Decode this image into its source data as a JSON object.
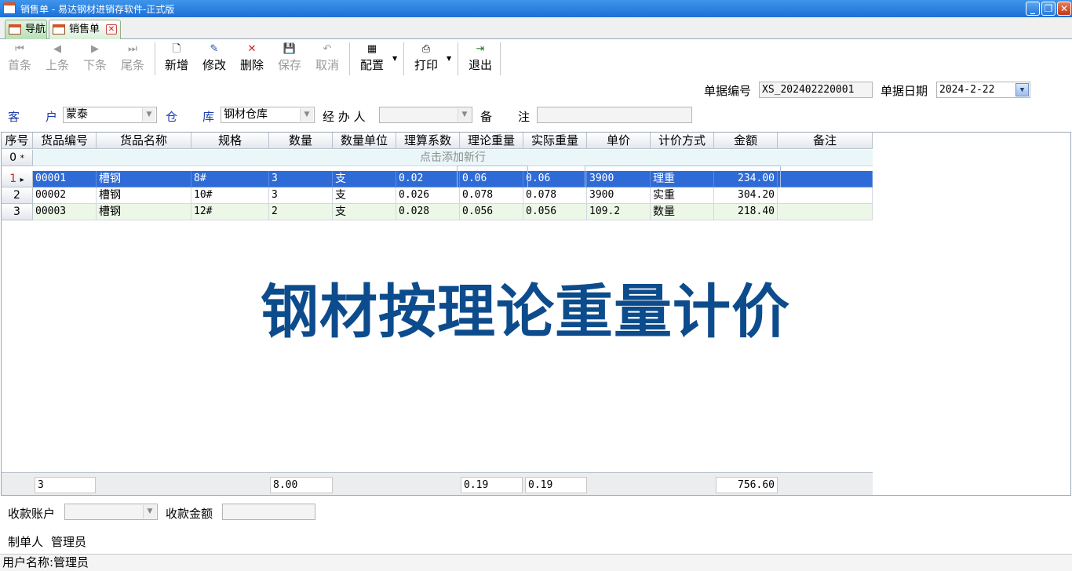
{
  "window": {
    "title": "销售单 - 易达钢材进销存软件-正式版",
    "min_glyph": "_",
    "max_glyph": "❐",
    "close_glyph": "✕"
  },
  "tabs": [
    {
      "label": "导航"
    },
    {
      "label": "销售单",
      "close_glyph": "✕"
    }
  ],
  "toolbar": {
    "first": "首条",
    "prev": "上条",
    "next": "下条",
    "last": "尾条",
    "new": "新增",
    "edit": "修改",
    "delete": "删除",
    "save": "保存",
    "cancel": "取消",
    "config": "配置",
    "print": "打印",
    "exit": "退出",
    "icons": {
      "first": "⏮",
      "prev": "◀",
      "next": "▶",
      "last": "⏭",
      "new": "🗋",
      "edit": "✎",
      "delete": "✕",
      "save": "💾",
      "cancel": "↶",
      "config": "▦",
      "print": "⎙",
      "exit": "⇥",
      "drop": "▼"
    }
  },
  "header": {
    "doc_no_label": "单据编号",
    "doc_no": "XS_202402220001",
    "doc_date_label": "单据日期",
    "doc_date": "2024-2-22",
    "customer_label_1": "客",
    "customer_label_2": "户",
    "customer": "蒙泰",
    "warehouse_label_1": "仓",
    "warehouse_label_2": "库",
    "warehouse": "钢材仓库",
    "handler_label": "经 办 人",
    "handler": "",
    "note_label_1": "备",
    "note_label_2": "注",
    "note": "",
    "dropdown_glyph": "▼"
  },
  "grid": {
    "columns": [
      "序号",
      "货品编号",
      "货品名称",
      "规格",
      "数量",
      "数量单位",
      "理算系数",
      "理论重量",
      "实际重量",
      "单价",
      "计价方式",
      "金额",
      "备注"
    ],
    "new_row": {
      "index": "0",
      "marker": "*",
      "text": "点击添加新行"
    },
    "current_marker": "▸",
    "rows": [
      {
        "index": "1",
        "code": "00001",
        "name": "槽钢",
        "spec": "8#",
        "qty": "3",
        "unit": "支",
        "coef": "0.02",
        "theo_wt": "0.06",
        "act_wt": "0.06",
        "price": "3900",
        "method": "理重",
        "amount": "234.00",
        "note": ""
      },
      {
        "index": "2",
        "code": "00002",
        "name": "槽钢",
        "spec": "10#",
        "qty": "3",
        "unit": "支",
        "coef": "0.026",
        "theo_wt": "0.078",
        "act_wt": "0.078",
        "price": "3900",
        "method": "实重",
        "amount": "304.20",
        "note": ""
      },
      {
        "index": "3",
        "code": "00003",
        "name": "槽钢",
        "spec": "12#",
        "qty": "2",
        "unit": "支",
        "coef": "0.028",
        "theo_wt": "0.056",
        "act_wt": "0.056",
        "price": "109.2",
        "method": "数量",
        "amount": "218.40",
        "note": ""
      }
    ]
  },
  "watermark": "钢材按理论重量计价",
  "totals": {
    "count": "3",
    "qty": "8.00",
    "theo_wt": "0.19",
    "act_wt": "0.19",
    "amount": "756.60"
  },
  "footer": {
    "account_label": "收款账户",
    "account": "",
    "amount_label": "收款金额",
    "amount": "",
    "maker_label": "制单人",
    "maker": "管理员"
  },
  "status": {
    "text": "用户名称:管理员"
  },
  "colors": {
    "selection": "#2f6bd6",
    "alt_row": "#ecf7e8",
    "titlebar": "#1c6fd6",
    "watermark": "#0d4c8c"
  }
}
